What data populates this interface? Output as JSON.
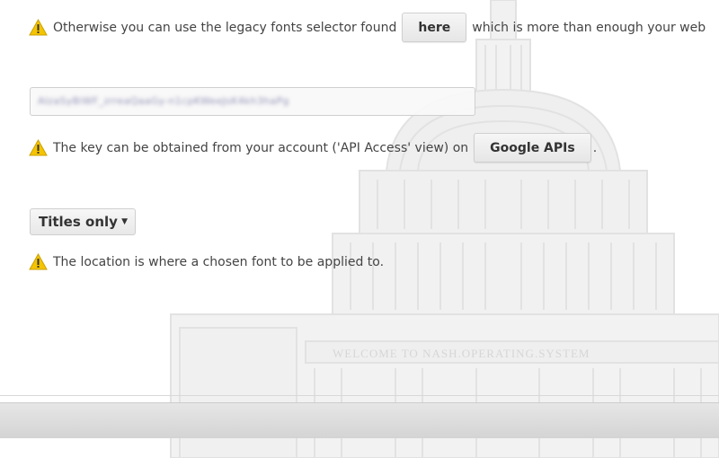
{
  "notices": {
    "legacy": {
      "text_before": "Otherwise you can use the legacy fonts selector found",
      "button_label": "here",
      "text_after": "which is more than enough your web"
    },
    "key": {
      "text_before": "The key can be obtained from your account ('API Access' view) on",
      "button_label": "Google APIs",
      "text_after": "."
    },
    "location": {
      "text": "The location is where a chosen font to be applied to."
    }
  },
  "api_key_field": {
    "value": "AIzaSyBiWF_zrreaQaaGy-n1cpKWeeJsK4kh3haPg"
  },
  "location_select": {
    "selected": "Titles only"
  },
  "watermark": {
    "text": "WELCOME TO NASH.OPERATING.SYSTEM"
  },
  "colors": {
    "warning": "#f5c400",
    "text": "#444444"
  }
}
